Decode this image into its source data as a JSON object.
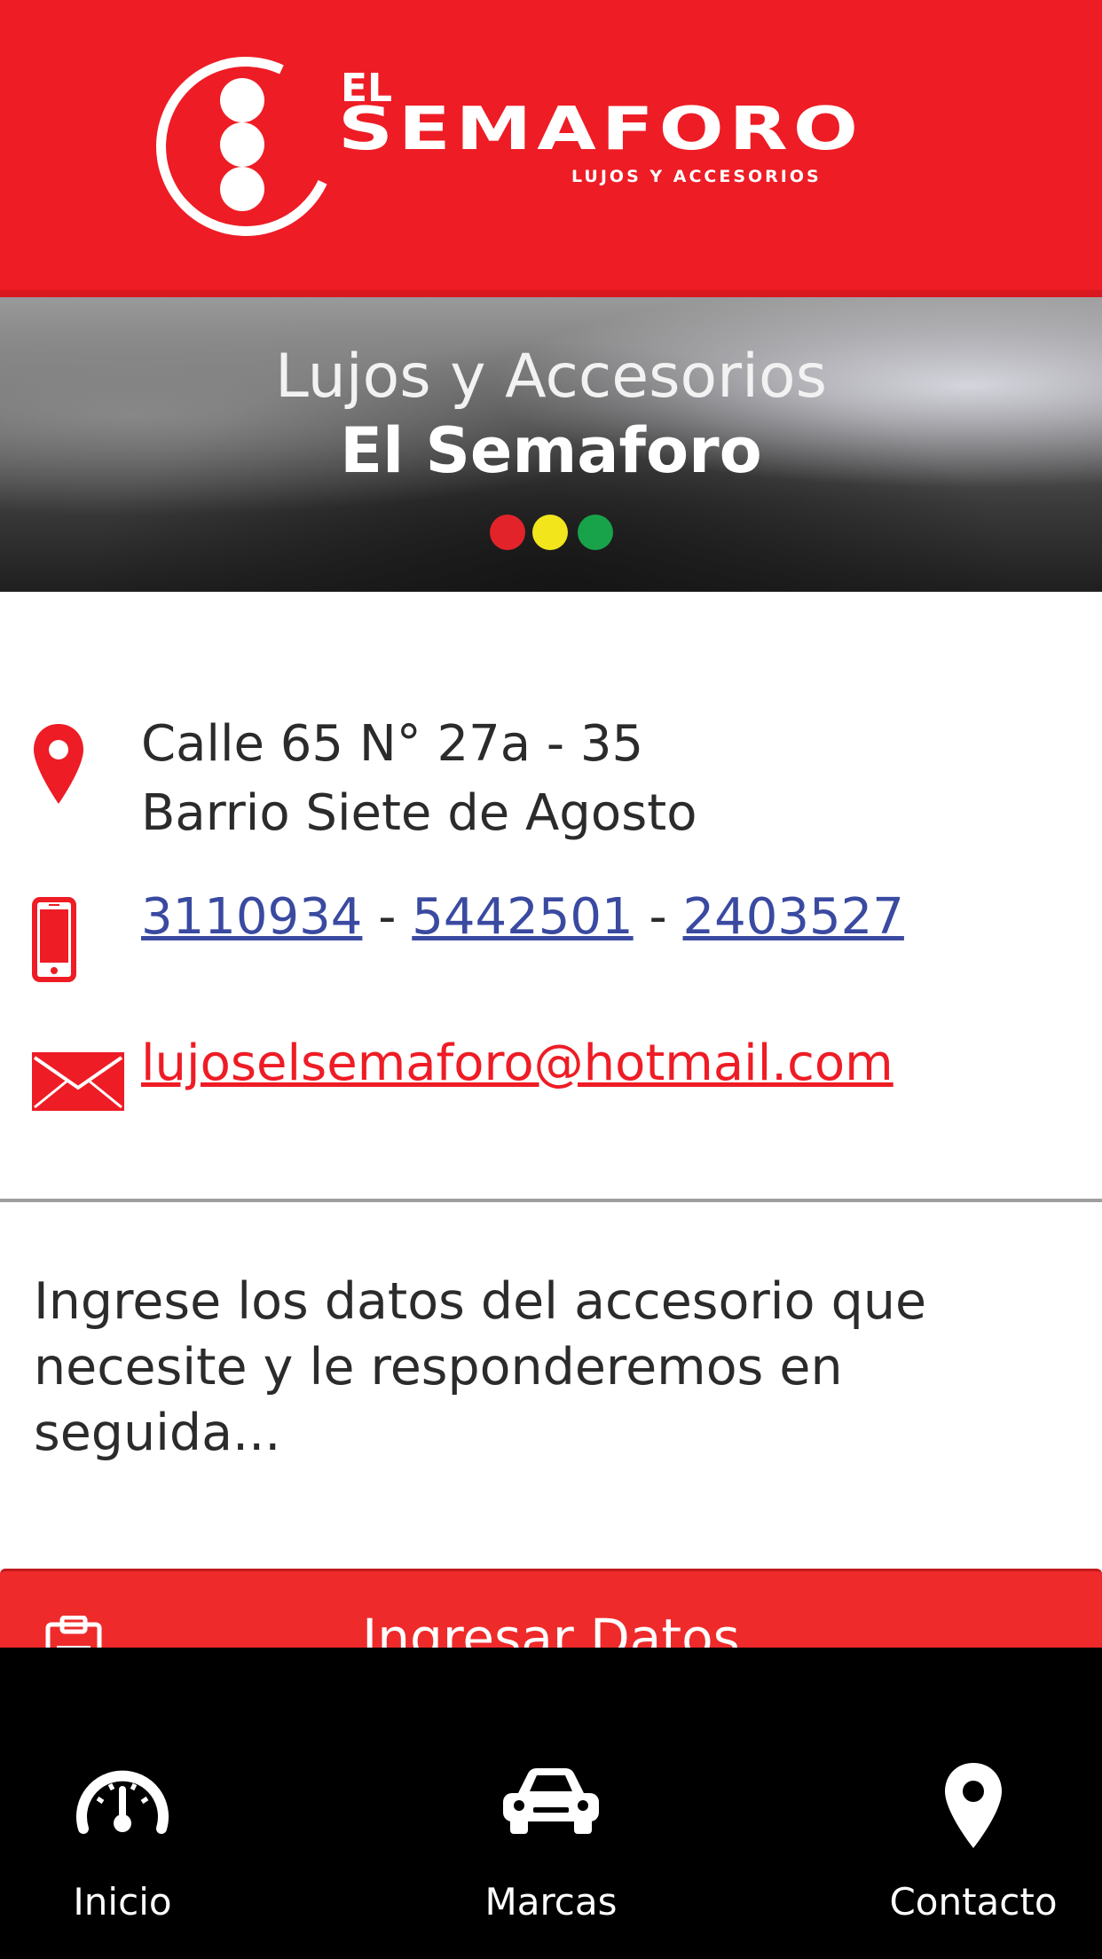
{
  "header": {
    "logo_el": "EL",
    "logo_word": "SEMAFORO",
    "logo_sub": "LUJOS Y ACCESORIOS"
  },
  "banner": {
    "line1": "Lujos y Accesorios",
    "line2": "El Semaforo",
    "lights": [
      "#e2242a",
      "#f2e51c",
      "#18a34a"
    ]
  },
  "contact": {
    "address_line1": "Calle 65 N° 27a - 35",
    "address_line2": "Barrio Siete de Agosto",
    "phones": [
      "3110934",
      "5442501",
      "2403527"
    ],
    "phone_separator": "-",
    "email": "lujoselsemaforo@hotmail.com"
  },
  "description": "Ingrese los datos del accesorio que necesite y le responderemos en seguida...",
  "cta": {
    "label": "Ingresar Datos"
  },
  "bottom_nav": {
    "items": [
      {
        "label": "Inicio",
        "icon": "speedometer-icon"
      },
      {
        "label": "Marcas",
        "icon": "car-icon"
      },
      {
        "label": "Contacto",
        "icon": "location-pin-icon"
      }
    ]
  },
  "colors": {
    "brand_red": "#ee1c25",
    "link_blue": "#3a4aa0",
    "nav_bg": "#000000"
  }
}
